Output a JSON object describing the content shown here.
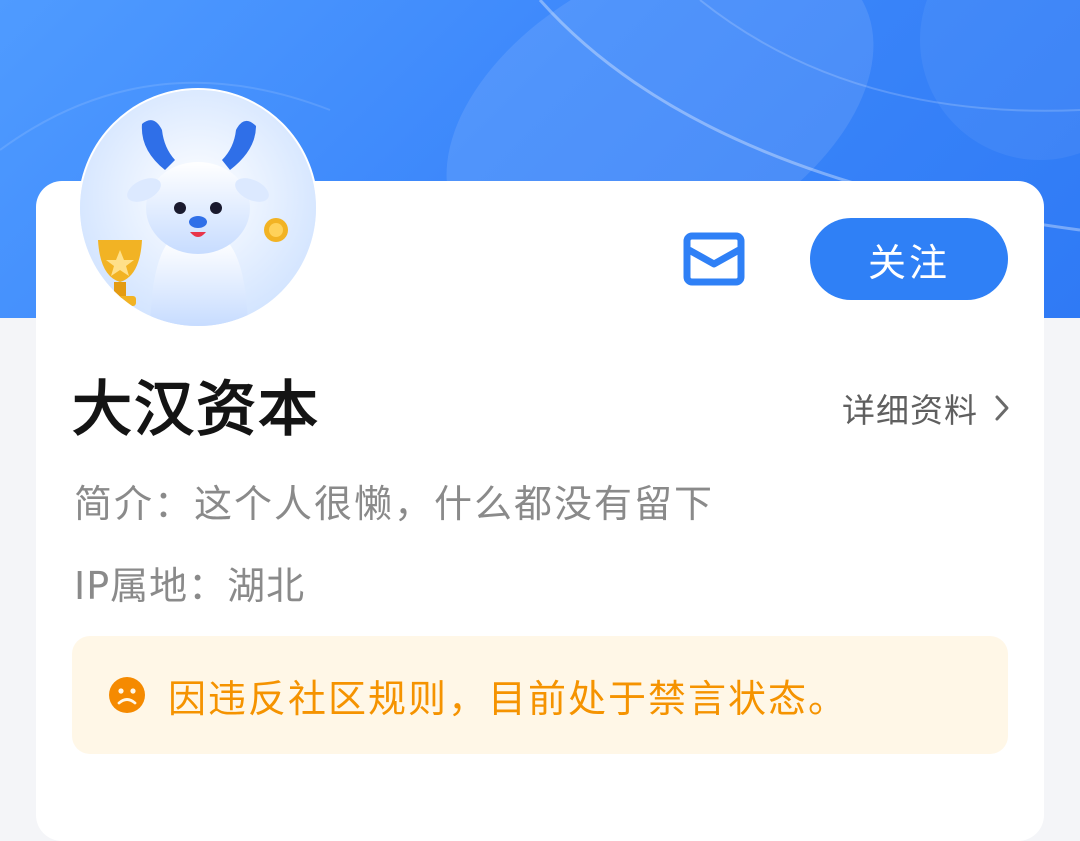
{
  "profile": {
    "name": "大汉资本",
    "detail_label": "详细资料",
    "bio": "简介：这个人很懒，什么都没有留下",
    "ip_location": "IP属地：湖北"
  },
  "actions": {
    "follow_label": "关注",
    "message_icon": "envelope-icon"
  },
  "notice": {
    "icon": "sad-face-icon",
    "text": "因违反社区规则，目前处于禁言状态。"
  },
  "colors": {
    "header_blue": "#3d88fb",
    "follow_button": "#2f80f6",
    "notice_background": "#fff7e7",
    "notice_text": "#f59300",
    "name_text": "#141414",
    "secondary_text": "#8a8a8a"
  }
}
